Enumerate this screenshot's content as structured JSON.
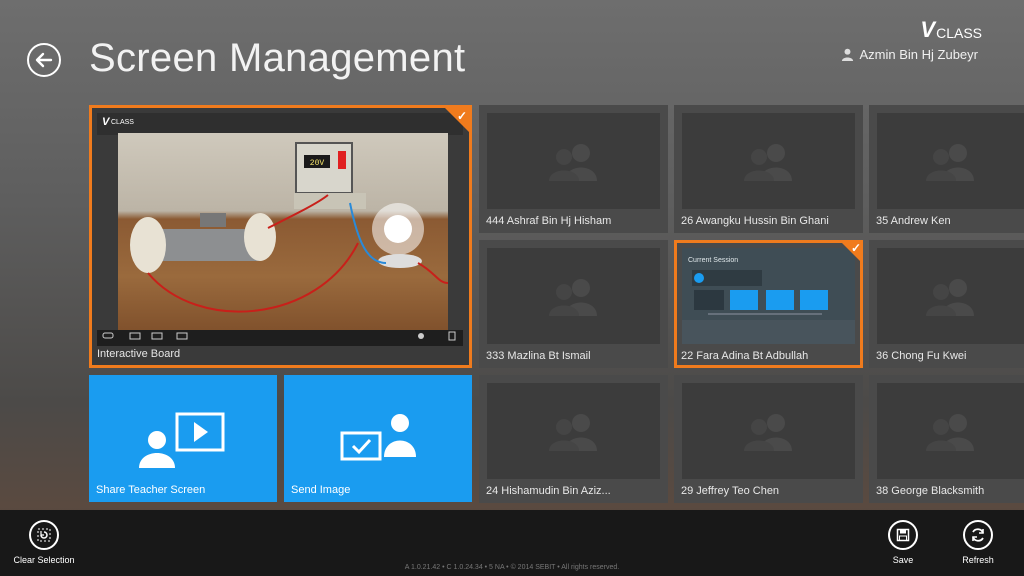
{
  "brand": {
    "v": "V",
    "text": "CLASS"
  },
  "header": {
    "title": "Screen Management",
    "user": "Azmin Bin Hj Zubeyr"
  },
  "interactive_board": {
    "label": "Interactive Board",
    "brand": "CLASS",
    "meter_value": "20V"
  },
  "actions": {
    "share_teacher_screen": "Share Teacher Screen",
    "send_image": "Send Image"
  },
  "students": [
    {
      "name": "444   Ashraf Bin Hj Hisham",
      "selected": false
    },
    {
      "name": "26   Awangku Hussin Bin Ghani",
      "selected": false
    },
    {
      "name": "35   Andrew Ken",
      "selected": false
    },
    {
      "name": "333   Mazlina Bt Ismail",
      "selected": false
    },
    {
      "name": "22   Fara Adina Bt Adbullah",
      "selected": true
    },
    {
      "name": "36   Chong Fu Kwei",
      "selected": false
    },
    {
      "name": "24   Hishamudin Bin Aziz...",
      "selected": false
    },
    {
      "name": "29   Jeffrey Teo Chen",
      "selected": false
    },
    {
      "name": "38   George Blacksmith",
      "selected": false
    }
  ],
  "fara_preview": {
    "title": "Current Session"
  },
  "appbar": {
    "clear_selection": "Clear Selection",
    "save": "Save",
    "refresh": "Refresh"
  },
  "footer": "A 1.0.21.42 • C 1.0.24.34 • 5 NA • © 2014 SEBIT • All rights reserved.",
  "colors": {
    "accent": "#f07b1d",
    "action_blue": "#1a9cf0"
  }
}
